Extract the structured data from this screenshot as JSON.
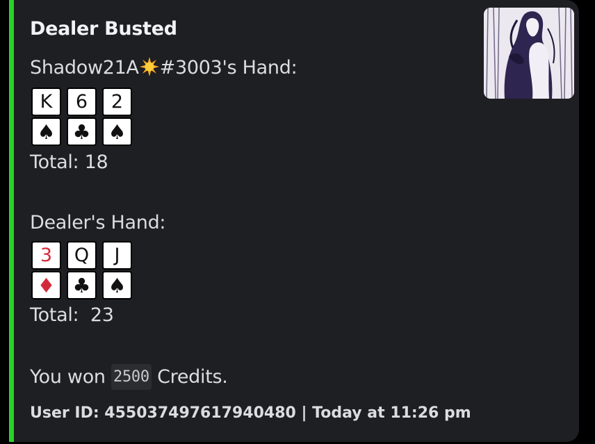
{
  "embed": {
    "accent_color": "#2ad32a",
    "title": "Dealer Busted",
    "player_hand": {
      "label_prefix": "Shadow21A",
      "label_emoji": "sun-emoji",
      "label_suffix": "#3003's Hand:",
      "cards": [
        {
          "rank": "K",
          "suit": "♠",
          "color": "black"
        },
        {
          "rank": "6",
          "suit": "♣",
          "color": "black"
        },
        {
          "rank": "2",
          "suit": "♠",
          "color": "black"
        }
      ],
      "total": "Total: 18"
    },
    "dealer_hand": {
      "label": "Dealer's Hand:",
      "cards": [
        {
          "rank": "3",
          "suit": "♦",
          "color": "red"
        },
        {
          "rank": "Q",
          "suit": "♣",
          "color": "black"
        },
        {
          "rank": "J",
          "suit": "♠",
          "color": "black"
        }
      ],
      "total": "Total:  23"
    },
    "result": {
      "prefix": "You won ",
      "amount": "2500",
      "suffix": " Credits."
    },
    "footer": "User ID: 455037497617940480 | Today at 11:26 pm",
    "thumbnail": "anime-illustration-thumbnail"
  }
}
